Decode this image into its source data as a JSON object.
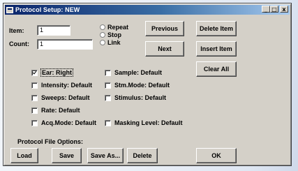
{
  "window": {
    "title": "Protocol Setup: NEW"
  },
  "title_controls": {
    "minimize": "_",
    "maximize": "□",
    "close": "x"
  },
  "fields": {
    "item": {
      "label": "Item:",
      "value": "1"
    },
    "count": {
      "label": "Count:",
      "value": "1"
    }
  },
  "radios": [
    {
      "label": "Repeat",
      "selected": false
    },
    {
      "label": "Stop",
      "selected": false
    },
    {
      "label": "Link",
      "selected": false
    }
  ],
  "buttons": {
    "previous": "Previous",
    "next": "Next",
    "delete_item": "Delete Item",
    "insert_item": "Insert Item",
    "clear_all": "Clear All"
  },
  "checkboxes_left": [
    {
      "label": "Ear: Right",
      "checked": true
    },
    {
      "label": "Intensity: Default",
      "checked": false
    },
    {
      "label": "Sweeps: Default",
      "checked": false
    },
    {
      "label": "Rate: Default",
      "checked": false
    },
    {
      "label": "Acq.Mode: Default",
      "checked": false
    }
  ],
  "checkboxes_right": [
    {
      "label": "Sample: Default",
      "checked": false
    },
    {
      "label": "Stm.Mode: Default",
      "checked": false
    },
    {
      "label": "Stimulus: Default",
      "checked": false
    },
    {
      "label": "Masking Level: Default",
      "checked": false
    }
  ],
  "file_options": {
    "label": "Protocol File Options:",
    "load": "Load",
    "save": "Save",
    "save_as": "Save As...",
    "delete": "Delete"
  },
  "ok": "OK"
}
